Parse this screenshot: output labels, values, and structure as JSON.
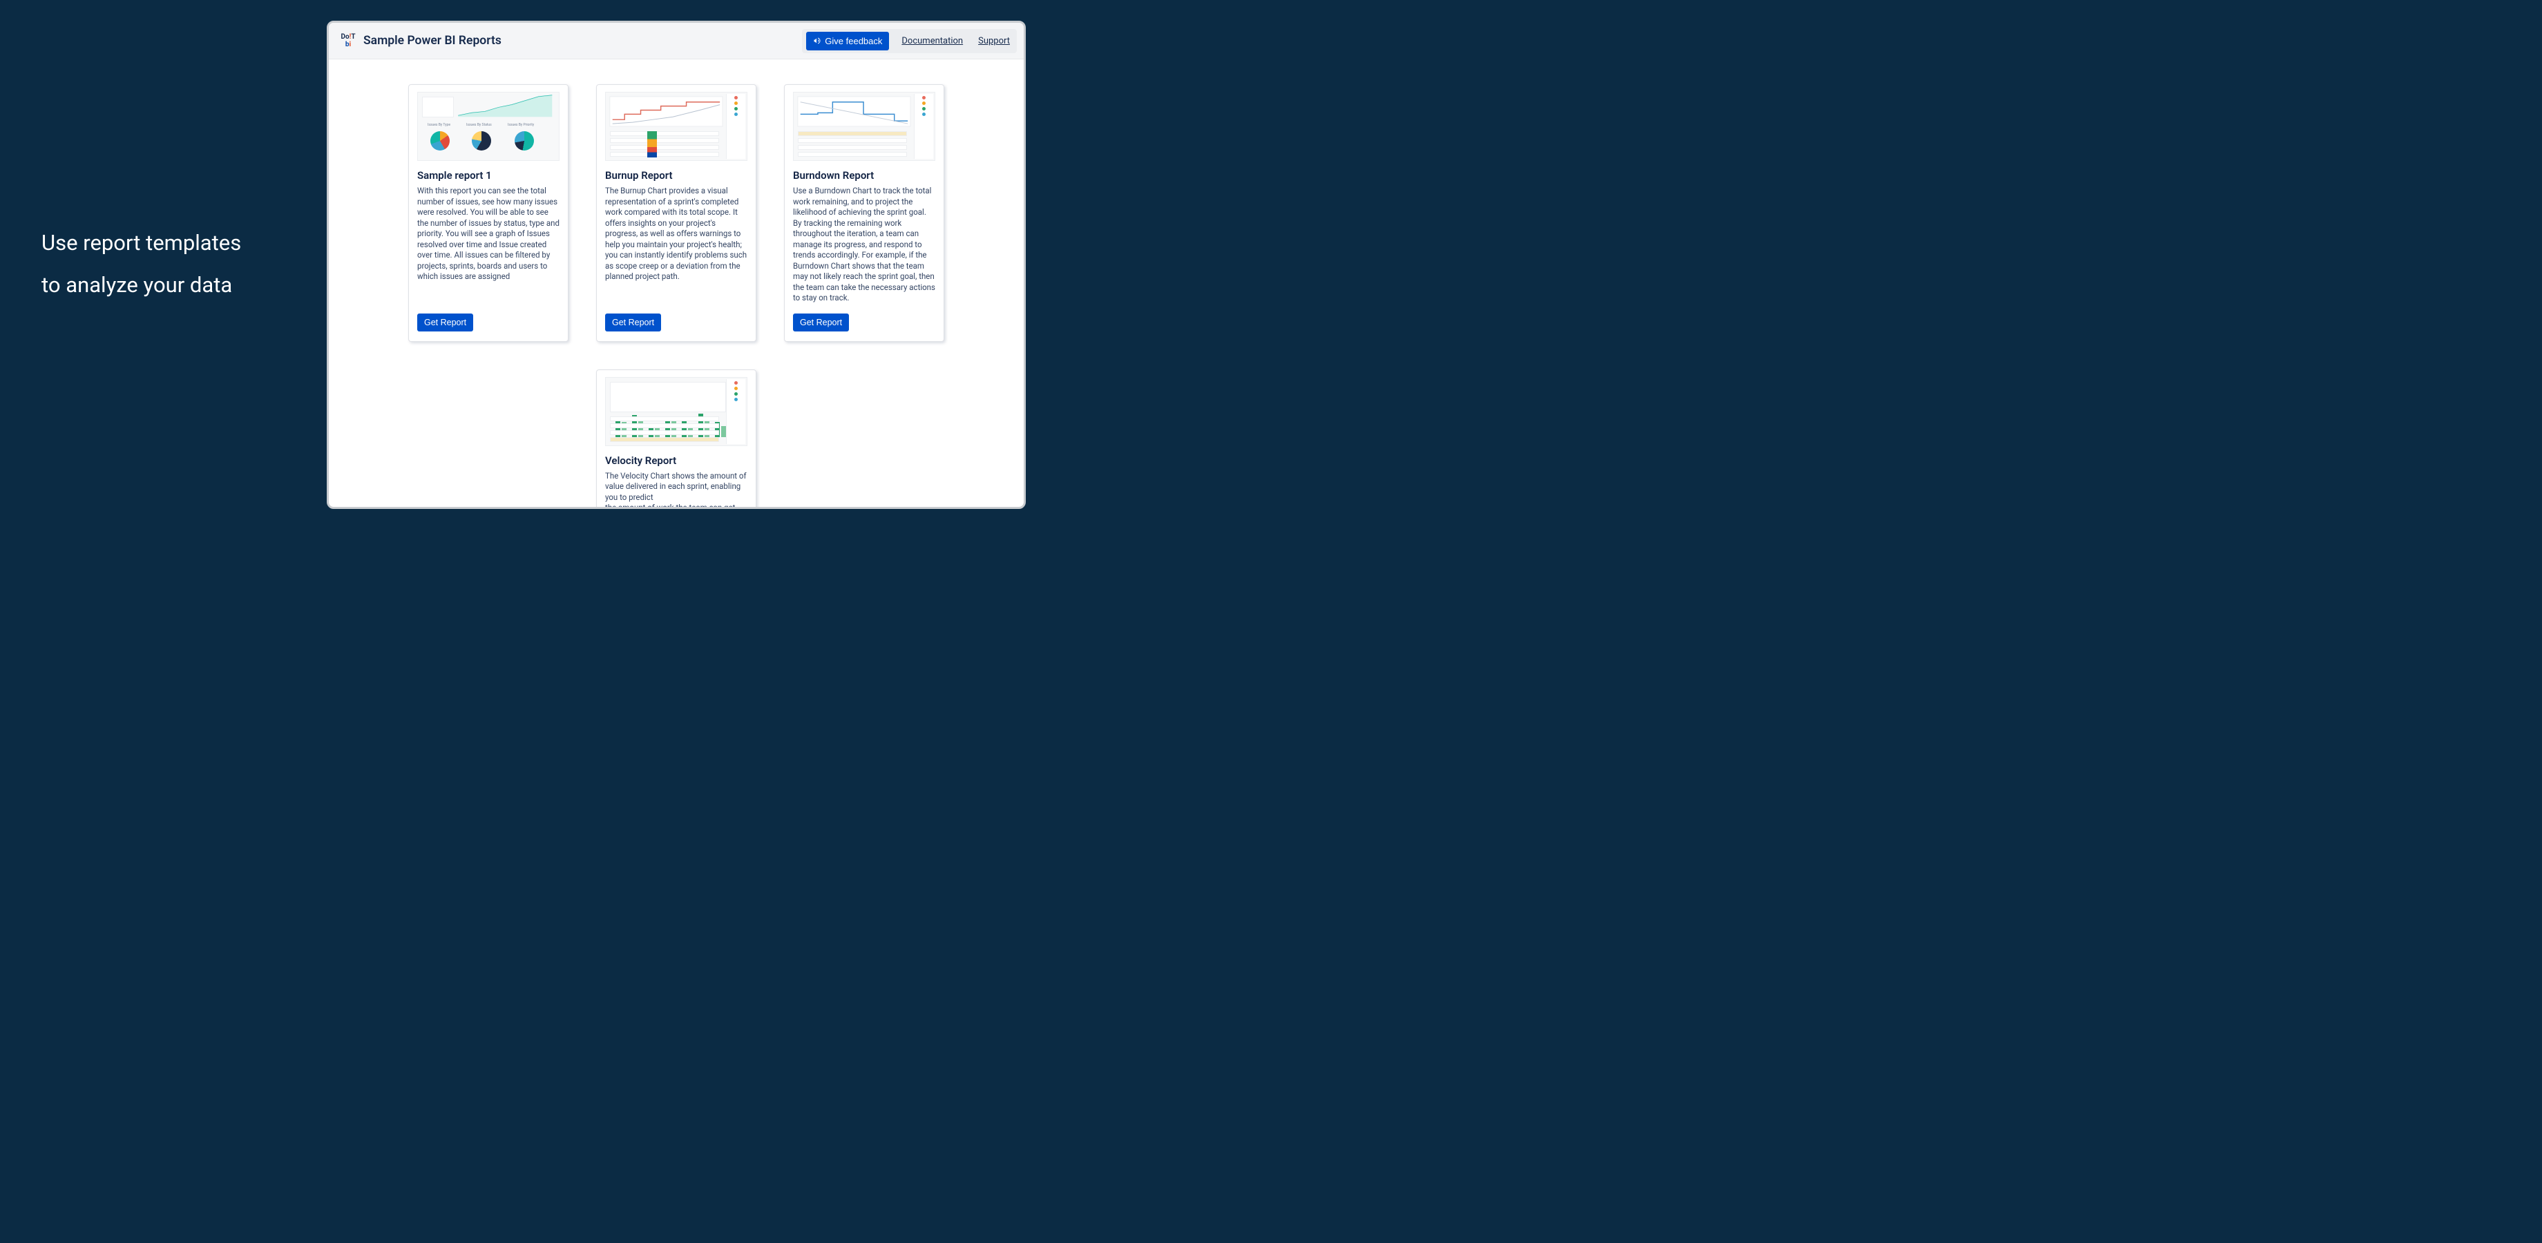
{
  "left_panel": {
    "line1": "Use report templates",
    "line2": "to analyze your data"
  },
  "header": {
    "title": "Sample Power BI Reports",
    "feedback_label": "Give feedback",
    "documentation_label": "Documentation",
    "support_label": "Support"
  },
  "get_report_label": "Get Report",
  "cards": [
    {
      "title": "Sample report 1",
      "desc": "With this report you can see the total number of issues, see how many issues were resolved. You will be able to see the number of issues by status, type and priority. You will see a graph of Issues resolved over time and Issue created over time. All issues can be filtered by projects, sprints, boards and users to which issues are assigned"
    },
    {
      "title": "Burnup Report",
      "desc": "The Burnup Chart provides a visual representation of a sprint's completed work compared with its total scope. It offers insights on your project's progress, as well as offers warnings to help you maintain your project's health; you can instantly identify problems such as scope creep or a deviation from the planned project path."
    },
    {
      "title": "Burndown Report",
      "desc": "Use a Burndown Chart to track the total work remaining, and to project the likelihood of achieving the sprint goal. By tracking the remaining work throughout the iteration, a team can manage its progress, and respond to trends accordingly. For example, if the Burndown Chart shows that the team may not likely reach the sprint goal, then the team can take the necessary actions to stay on track."
    },
    {
      "title": "Velocity Report",
      "desc": "The Velocity Chart shows the amount of value delivered in each sprint, enabling you to predict\nthe amount of work the team can get done in future sprints. It is useful during your sprint planning meetings,\nto help you decide how much work you can"
    }
  ]
}
